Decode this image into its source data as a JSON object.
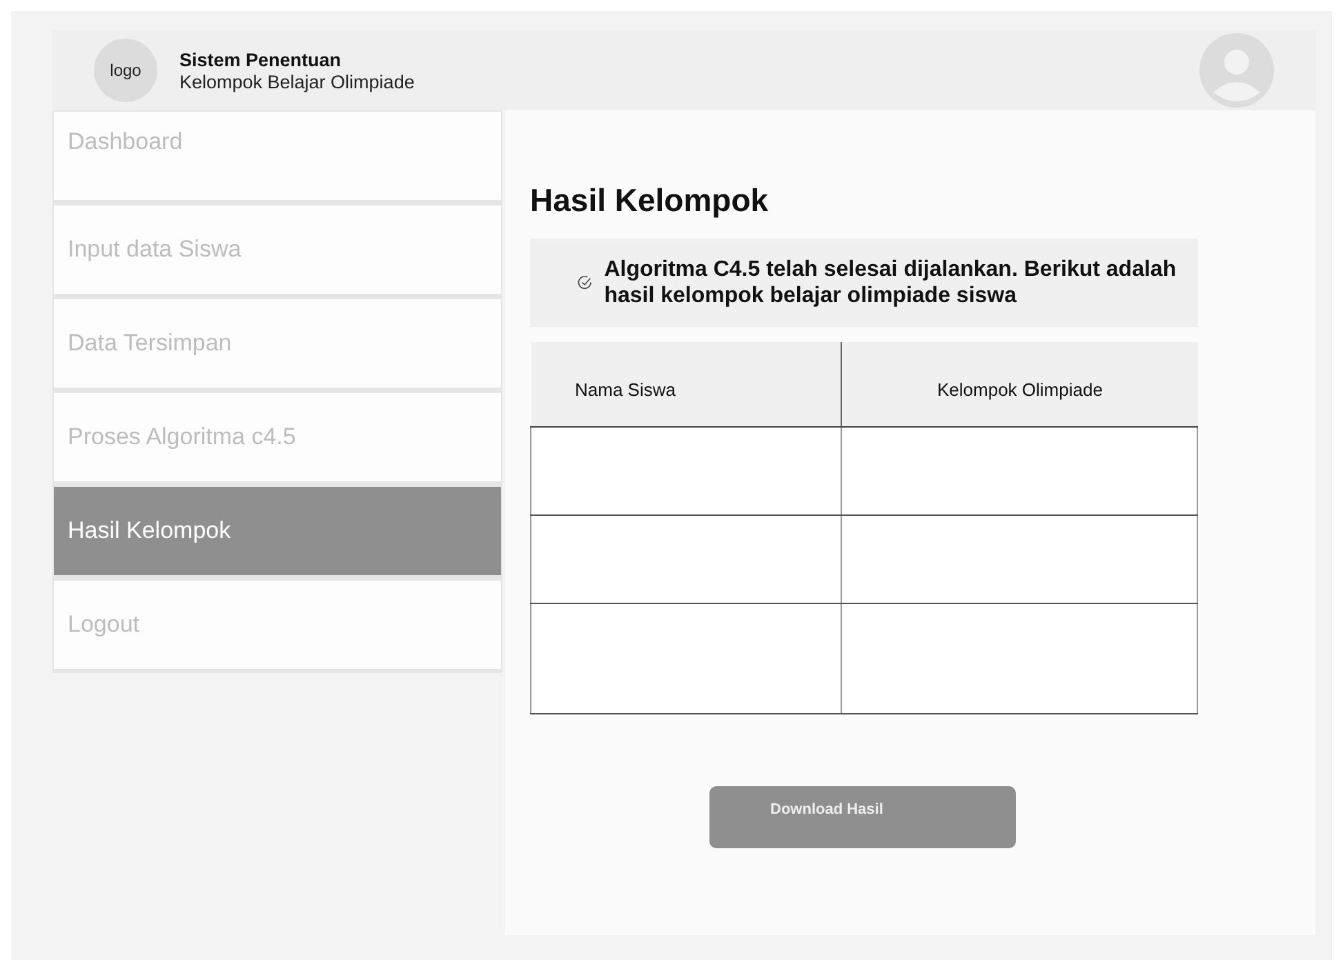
{
  "header": {
    "logo": "logo",
    "app_title": "Sistem Penentuan",
    "app_subtitle": "Kelompok Belajar Olimpiade"
  },
  "sidebar": {
    "items": [
      {
        "label": "Dashboard",
        "selected": false
      },
      {
        "label": "Input data Siswa",
        "selected": false
      },
      {
        "label": "Data Tersimpan",
        "selected": false
      },
      {
        "label": "Proses Algoritma c4.5",
        "selected": false
      },
      {
        "label": "Hasil Kelompok",
        "selected": true
      },
      {
        "label": "Logout",
        "selected": false
      }
    ]
  },
  "page_title": "Hasil Kelompok",
  "alert": {
    "message": "Algoritma C4.5 telah selesai dijalankan. Berikut adalah hasil kelompok belajar olimpiade siswa"
  },
  "table": {
    "columns": [
      "Nama Siswa",
      "Kelompok Olimpiade"
    ]
  },
  "download_button": "Download Hasil"
}
